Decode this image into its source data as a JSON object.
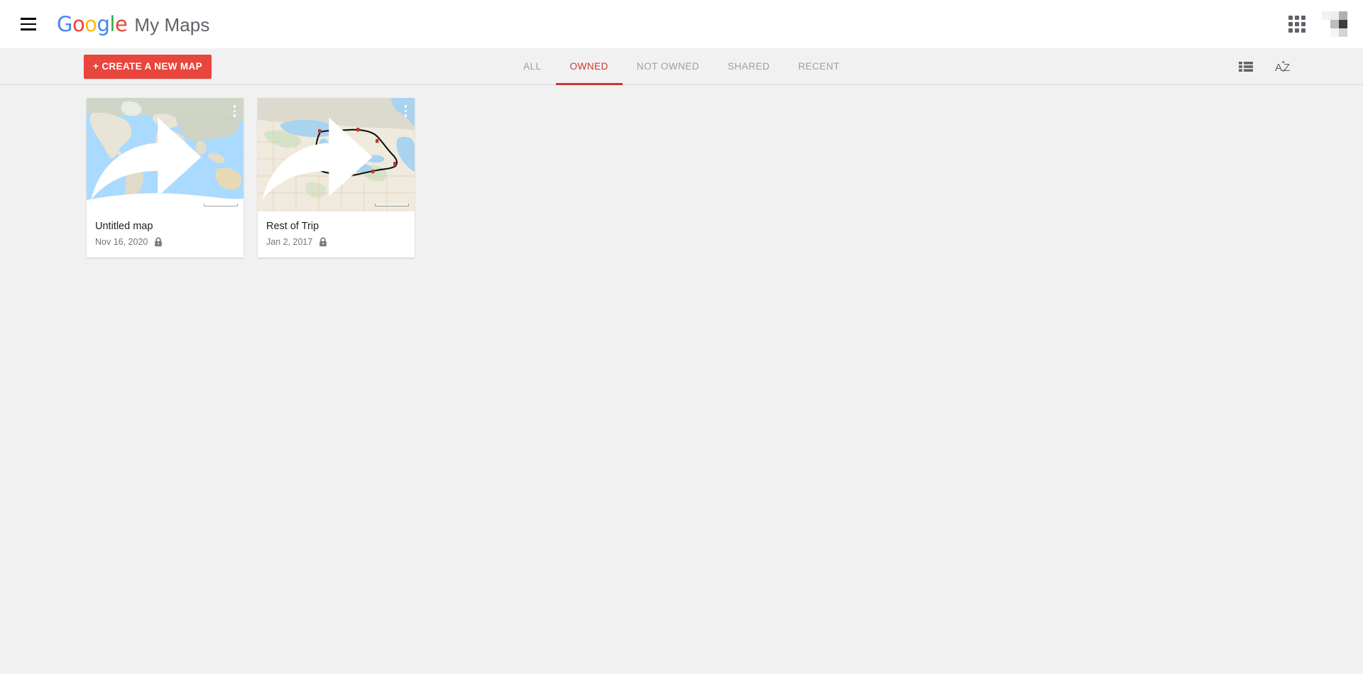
{
  "header": {
    "menu_icon": "hamburger-icon",
    "logo_text": "Google",
    "logo_letters": [
      {
        "char": "G",
        "color": "#4285f4"
      },
      {
        "char": "o",
        "color": "#ea4335"
      },
      {
        "char": "o",
        "color": "#fbbc05"
      },
      {
        "char": "g",
        "color": "#4285f4"
      },
      {
        "char": "l",
        "color": "#34a853"
      },
      {
        "char": "e",
        "color": "#ea4335"
      }
    ],
    "product_name": "My Maps",
    "apps_icon": "apps-grid-icon",
    "avatar_label": "account-avatar"
  },
  "toolbar": {
    "create_label": "+ CREATE A NEW MAP",
    "tabs": [
      {
        "label": "ALL",
        "active": false
      },
      {
        "label": "OWNED",
        "active": true
      },
      {
        "label": "NOT OWNED",
        "active": false
      },
      {
        "label": "SHARED",
        "active": false
      },
      {
        "label": "RECENT",
        "active": false
      }
    ],
    "list_view_icon": "list-view-icon",
    "sort_icon": "sort-alpha-icon"
  },
  "maps": [
    {
      "title": "Untitled map",
      "date": "Nov 16, 2020",
      "privacy": "private",
      "thumbnail": "world-map",
      "share_icon": "share-arrow-icon",
      "menu_icon": "more-vert-icon",
      "lock_icon": "lock-icon"
    },
    {
      "title": "Rest of Trip",
      "date": "Jan 2, 2017",
      "privacy": "private",
      "thumbnail": "great-lakes-route-map",
      "share_icon": "share-arrow-icon",
      "menu_icon": "more-vert-icon",
      "lock_icon": "lock-icon"
    }
  ],
  "colors": {
    "accent_red": "#e8453c",
    "active_tab_red": "#c5392f",
    "page_background": "#f1f1f1",
    "card_background": "#ffffff",
    "muted_text": "#757575"
  }
}
